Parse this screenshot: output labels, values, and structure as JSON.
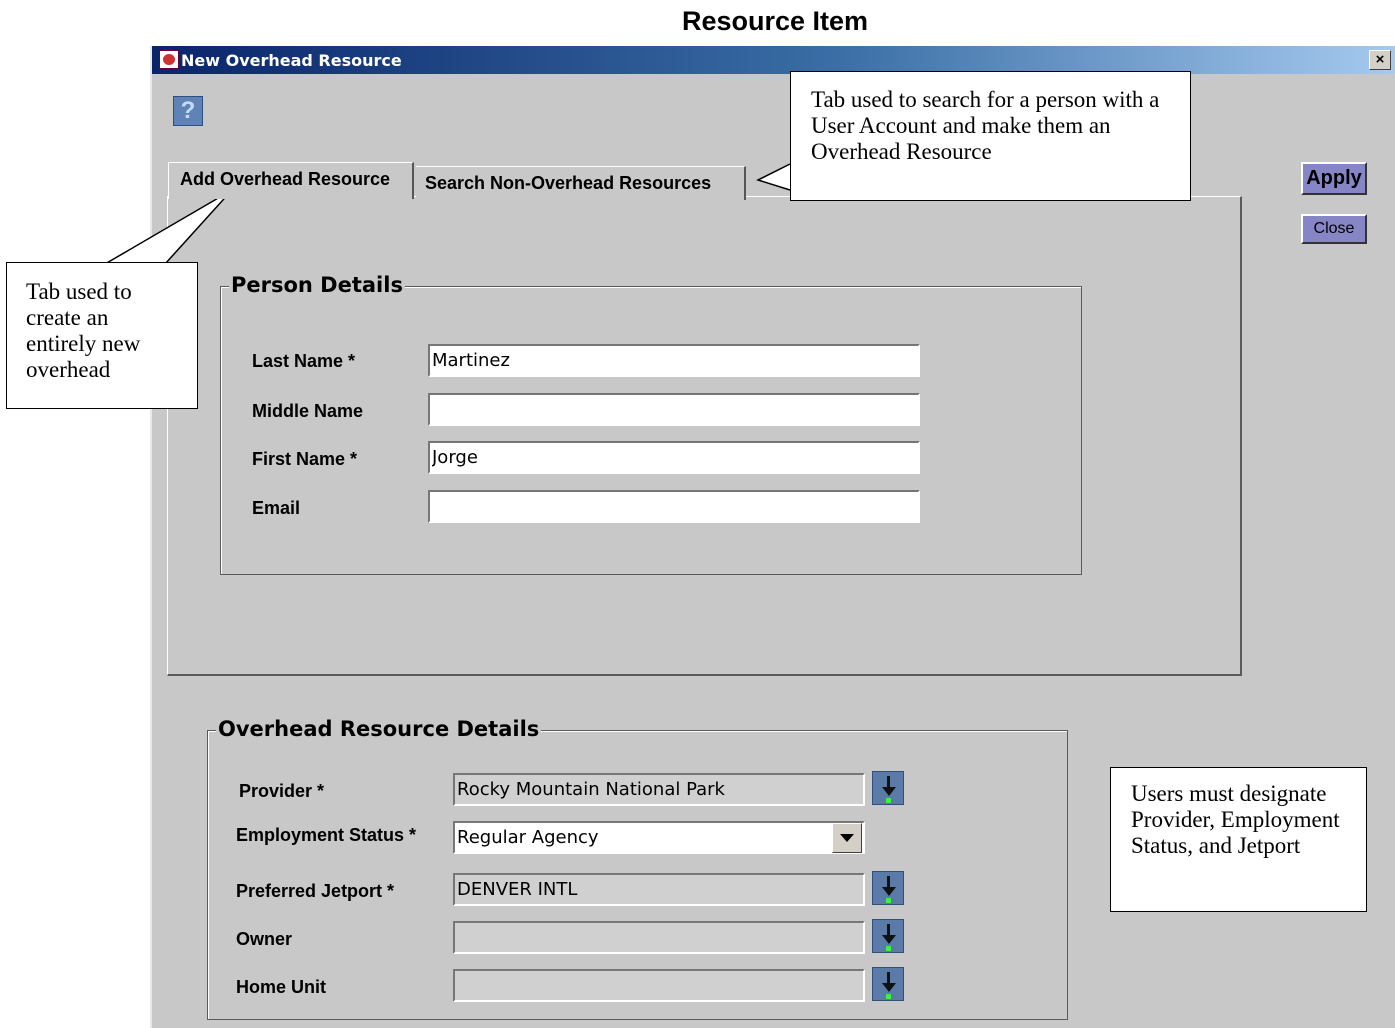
{
  "doc_title": "Resource Item",
  "window": {
    "title": "New Overhead Resource",
    "close_glyph": "×",
    "help_glyph": "?"
  },
  "tabs": [
    {
      "label": "Add Overhead Resource",
      "selected": true
    },
    {
      "label": "Search Non-Overhead Resources",
      "selected": false
    }
  ],
  "buttons": {
    "apply": "Apply",
    "close": "Close"
  },
  "person_details": {
    "title": "Person Details",
    "fields": [
      {
        "label": "Last Name *",
        "value": "Martinez"
      },
      {
        "label": "Middle Name",
        "value": ""
      },
      {
        "label": "First Name *",
        "value": "Jorge"
      },
      {
        "label": "Email",
        "value": ""
      }
    ]
  },
  "overhead_details": {
    "title": "Overhead Resource Details",
    "fields": [
      {
        "label": "Provider *",
        "value": "Rocky Mountain National Park",
        "control": "browse"
      },
      {
        "label": "Employment Status *",
        "value": "Regular Agency",
        "control": "dropdown"
      },
      {
        "label": "Preferred Jetport *",
        "value": "DENVER INTL",
        "control": "browse"
      },
      {
        "label": "Owner",
        "value": "",
        "control": "browse"
      },
      {
        "label": "Home Unit",
        "value": "",
        "control": "browse"
      }
    ]
  },
  "callouts": {
    "search_tab": "Tab used to search for a person with a User Account and make them an Overhead Resource",
    "add_tab": "Tab used to create an entirely new overhead",
    "users": "Users must designate Provider, Employment Status, and Jetport"
  },
  "icons": {
    "app": "app-icon",
    "help": "help-icon",
    "browse": "browse-arrow-icon",
    "dropdown": "chevron-down-icon",
    "close": "close-icon"
  }
}
